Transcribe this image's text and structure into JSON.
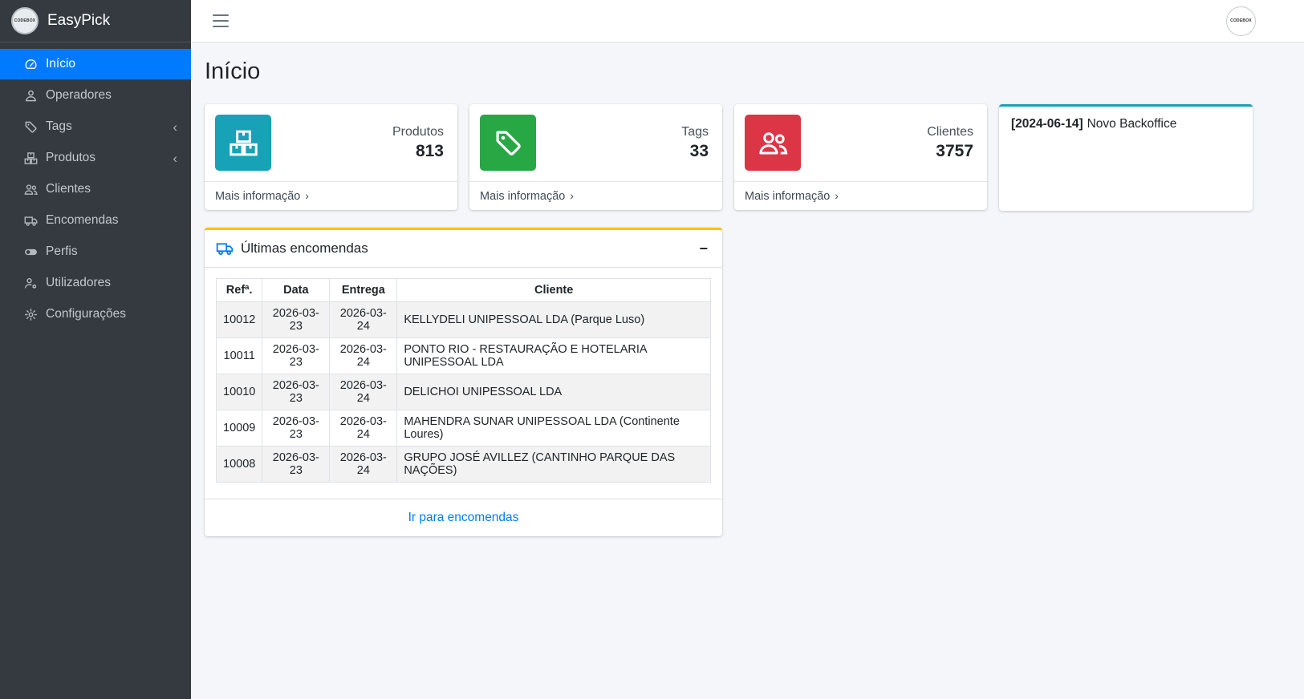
{
  "app": {
    "brand": "EasyPick",
    "logo_text": "CODEBOX"
  },
  "sidebar": {
    "items": [
      {
        "id": "inicio",
        "label": "Início",
        "icon": "dashboard-icon",
        "active": true
      },
      {
        "id": "operadores",
        "label": "Operadores",
        "icon": "person-icon"
      },
      {
        "id": "tags",
        "label": "Tags",
        "icon": "tag-icon",
        "has_submenu": true
      },
      {
        "id": "produtos",
        "label": "Produtos",
        "icon": "boxes-icon",
        "has_submenu": true
      },
      {
        "id": "clientes",
        "label": "Clientes",
        "icon": "users-icon"
      },
      {
        "id": "encomendas",
        "label": "Encomendas",
        "icon": "truck-icon"
      },
      {
        "id": "perfis",
        "label": "Perfis",
        "icon": "toggle-icon"
      },
      {
        "id": "utilizadores",
        "label": "Utilizadores",
        "icon": "user-gear-icon"
      },
      {
        "id": "configuracoes",
        "label": "Configurações",
        "icon": "gear-icon"
      }
    ]
  },
  "page": {
    "title": "Início"
  },
  "info_boxes": [
    {
      "id": "produtos",
      "label": "Produtos",
      "value": "813",
      "color": "#17a2b8",
      "icon": "boxes-icon",
      "link_label": "Mais informação"
    },
    {
      "id": "tags",
      "label": "Tags",
      "value": "33",
      "color": "#28a745",
      "icon": "tag-icon",
      "link_label": "Mais informação"
    },
    {
      "id": "clientes",
      "label": "Clientes",
      "value": "3757",
      "color": "#dc3545",
      "icon": "users-icon",
      "link_label": "Mais informação"
    }
  ],
  "notice_card": {
    "accent_color": "#17a2b8",
    "date_label": "[2024-06-14]",
    "text": "Novo Backoffice"
  },
  "orders_card": {
    "accent_color": "#ffc107",
    "icon": "truck-icon",
    "title": "Últimas encomendas",
    "columns": [
      "Refª.",
      "Data",
      "Entrega",
      "Cliente"
    ],
    "rows": [
      [
        "10012",
        "2026-03-23",
        "2026-03-24",
        "KELLYDELI UNIPESSOAL LDA (Parque Luso)"
      ],
      [
        "10011",
        "2026-03-23",
        "2026-03-24",
        "PONTO RIO - RESTAURAÇÃO E HOTELARIA UNIPESSOAL LDA"
      ],
      [
        "10010",
        "2026-03-23",
        "2026-03-24",
        "DELICHOI UNIPESSOAL LDA"
      ],
      [
        "10009",
        "2026-03-23",
        "2026-03-24",
        "MAHENDRA SUNAR UNIPESSOAL LDA (Continente Loures)"
      ],
      [
        "10008",
        "2026-03-23",
        "2026-03-24",
        "GRUPO JOSÉ AVILLEZ (CANTINHO PARQUE DAS NAÇÕES)"
      ]
    ],
    "footer_link": "Ir para encomendas"
  }
}
